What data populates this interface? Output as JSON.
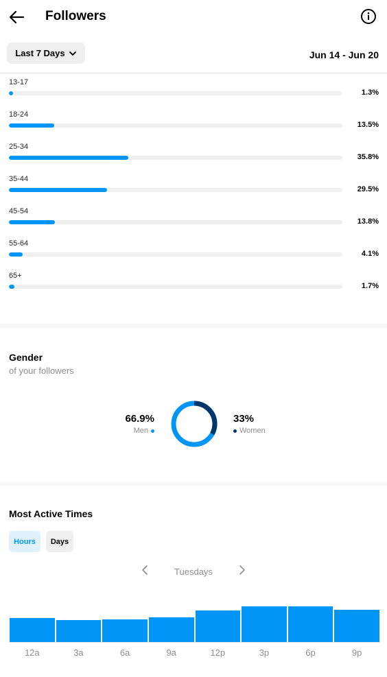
{
  "header": {
    "title": "Followers",
    "back_icon": "arrow-left-icon",
    "info_icon": "info-circle-icon"
  },
  "filters": {
    "range_label": "Last 7 Days",
    "range_icon": "chevron-down-icon",
    "date_range": "Jun 14 - Jun 20"
  },
  "age": [
    {
      "label": "13-17",
      "pct": "1.3%",
      "value": 1.3
    },
    {
      "label": "18-24",
      "pct": "13.5%",
      "value": 13.5
    },
    {
      "label": "25-34",
      "pct": "35.8%",
      "value": 35.8
    },
    {
      "label": "35-44",
      "pct": "29.5%",
      "value": 29.5
    },
    {
      "label": "45-54",
      "pct": "13.8%",
      "value": 13.8
    },
    {
      "label": "55-64",
      "pct": "4.1%",
      "value": 4.1
    },
    {
      "label": "65+",
      "pct": "1.7%",
      "value": 1.7
    }
  ],
  "gender": {
    "title": "Gender",
    "subtitle": "of your followers",
    "men_pct": "66.9%",
    "men_label": "Men",
    "men_value": 66.9,
    "women_pct": "33%",
    "women_label": "Women",
    "women_value": 33,
    "men_color": "#0095f6",
    "women_color": "#00376b"
  },
  "active": {
    "title": "Most Active Times",
    "tab_hours": "Hours",
    "tab_days": "Days",
    "day": "Tuesdays",
    "prev_icon": "chevron-left-icon",
    "next_icon": "chevron-right-icon"
  },
  "chart_data": {
    "type": "bar",
    "categories": [
      "12a",
      "3a",
      "6a",
      "9a",
      "12p",
      "3p",
      "6p",
      "9p"
    ],
    "values": [
      46,
      42,
      44,
      47,
      60,
      68,
      68,
      62
    ],
    "ylim": [
      0,
      100
    ],
    "color": "#0095f6"
  }
}
